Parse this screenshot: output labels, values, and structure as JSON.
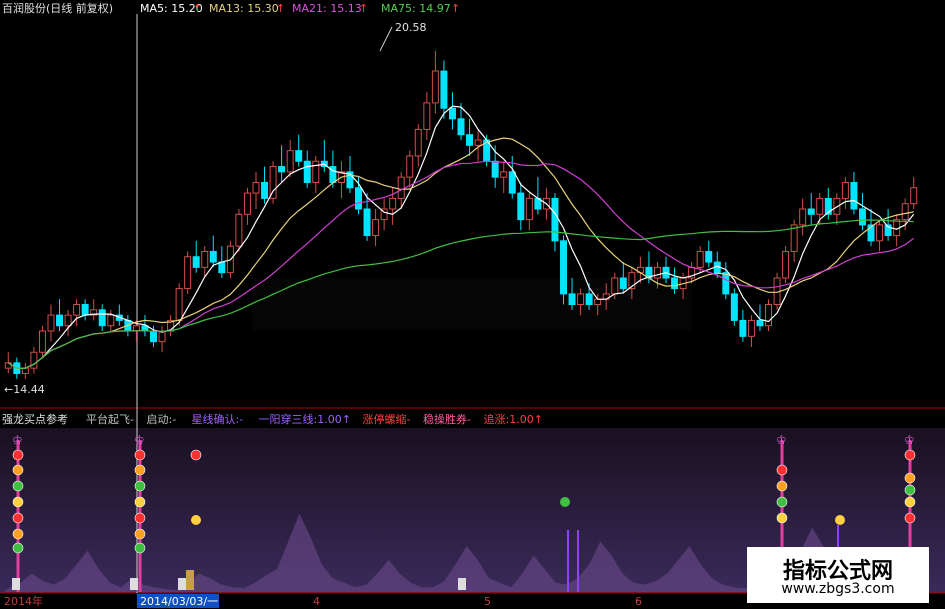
{
  "header": {
    "title": "百润股份(日线 前复权)",
    "ma5": "MA5: 15.20",
    "ma13": "MA13: 15.30",
    "ma21": "MA21: 15.13",
    "ma75": "MA75: 14.97",
    "arrow": "↑"
  },
  "annotations": {
    "high": "20.58",
    "low": "←14.44"
  },
  "indicator": {
    "name": "强龙买点参考",
    "items": [
      {
        "label": "平台起飞",
        "suffix": "-"
      },
      {
        "label": "启动",
        "suffix": ":-"
      },
      {
        "label": "星线确认",
        "suffix": ":-"
      },
      {
        "label": "一阳穿三线",
        "suffix": ":1.00↑"
      },
      {
        "label": "涨停螺缩",
        "suffix": "-"
      },
      {
        "label": "稳操胜券",
        "suffix": "-"
      },
      {
        "label": "追涨",
        "suffix": ":1.00↑"
      }
    ]
  },
  "axis": {
    "labels": [
      "2014年",
      "2014/03/03/一",
      "4",
      "5",
      "6"
    ]
  },
  "watermark": {
    "title": "指标公式网",
    "url": "www.zbgs3.com"
  },
  "colors": {
    "background": "#000000",
    "up": "#d2504c",
    "down": "#00e5ff",
    "ma5": "#ffffff",
    "ma13": "#e8d27a",
    "ma21": "#d040d0",
    "ma75": "#40c040",
    "indicatorBg": "#2a1a3a"
  },
  "chart_data": {
    "type": "candlestick",
    "ylim": [
      14.0,
      21.2
    ],
    "high_marker": 20.58,
    "low_marker": 14.44,
    "candles": [
      [
        14.6,
        14.9,
        14.5,
        14.7
      ],
      [
        14.7,
        14.8,
        14.4,
        14.5
      ],
      [
        14.5,
        14.7,
        14.4,
        14.6
      ],
      [
        14.6,
        15.0,
        14.5,
        14.9
      ],
      [
        14.9,
        15.4,
        14.8,
        15.3
      ],
      [
        15.3,
        15.8,
        15.1,
        15.6
      ],
      [
        15.6,
        15.9,
        15.3,
        15.4
      ],
      [
        15.4,
        15.7,
        15.2,
        15.6
      ],
      [
        15.6,
        15.9,
        15.4,
        15.8
      ],
      [
        15.8,
        15.9,
        15.5,
        15.6
      ],
      [
        15.6,
        15.9,
        15.5,
        15.7
      ],
      [
        15.7,
        15.8,
        15.3,
        15.4
      ],
      [
        15.4,
        15.7,
        15.3,
        15.6
      ],
      [
        15.6,
        15.8,
        15.4,
        15.5
      ],
      [
        15.5,
        15.6,
        15.2,
        15.3
      ],
      [
        15.3,
        15.5,
        15.1,
        15.4
      ],
      [
        15.4,
        15.6,
        15.2,
        15.3
      ],
      [
        15.3,
        15.4,
        15.0,
        15.1
      ],
      [
        15.1,
        15.4,
        14.9,
        15.3
      ],
      [
        15.3,
        15.6,
        15.2,
        15.5
      ],
      [
        15.5,
        16.2,
        15.4,
        16.1
      ],
      [
        16.1,
        16.8,
        16.0,
        16.7
      ],
      [
        16.7,
        17.0,
        16.4,
        16.5
      ],
      [
        16.5,
        16.9,
        16.3,
        16.8
      ],
      [
        16.8,
        17.1,
        16.5,
        16.6
      ],
      [
        16.6,
        16.9,
        16.3,
        16.4
      ],
      [
        16.4,
        17.0,
        16.3,
        16.9
      ],
      [
        16.9,
        17.6,
        16.8,
        17.5
      ],
      [
        17.5,
        18.0,
        17.3,
        17.9
      ],
      [
        17.9,
        18.3,
        17.6,
        18.1
      ],
      [
        18.1,
        18.4,
        17.7,
        17.8
      ],
      [
        17.8,
        18.5,
        17.7,
        18.4
      ],
      [
        18.4,
        18.8,
        18.1,
        18.3
      ],
      [
        18.3,
        18.9,
        18.2,
        18.7
      ],
      [
        18.7,
        19.0,
        18.4,
        18.5
      ],
      [
        18.5,
        18.7,
        18.0,
        18.1
      ],
      [
        18.1,
        18.6,
        17.9,
        18.5
      ],
      [
        18.5,
        18.9,
        18.3,
        18.4
      ],
      [
        18.4,
        18.7,
        18.0,
        18.1
      ],
      [
        18.1,
        18.5,
        17.8,
        18.3
      ],
      [
        18.3,
        18.6,
        17.9,
        18.0
      ],
      [
        18.0,
        18.2,
        17.5,
        17.6
      ],
      [
        17.6,
        17.9,
        17.0,
        17.1
      ],
      [
        17.1,
        17.6,
        16.9,
        17.4
      ],
      [
        17.4,
        17.8,
        17.2,
        17.6
      ],
      [
        17.6,
        18.0,
        17.3,
        17.8
      ],
      [
        17.8,
        18.3,
        17.6,
        18.2
      ],
      [
        18.2,
        18.7,
        18.0,
        18.6
      ],
      [
        18.6,
        19.2,
        18.4,
        19.1
      ],
      [
        19.1,
        19.8,
        18.9,
        19.6
      ],
      [
        19.6,
        20.58,
        19.4,
        20.2
      ],
      [
        20.2,
        20.4,
        19.3,
        19.5
      ],
      [
        19.5,
        19.8,
        19.1,
        19.3
      ],
      [
        19.3,
        19.6,
        18.9,
        19.0
      ],
      [
        19.0,
        19.3,
        18.6,
        18.8
      ],
      [
        18.8,
        19.1,
        18.5,
        18.9
      ],
      [
        18.9,
        19.0,
        18.4,
        18.5
      ],
      [
        18.5,
        18.8,
        18.0,
        18.2
      ],
      [
        18.2,
        18.5,
        17.9,
        18.3
      ],
      [
        18.3,
        18.6,
        17.8,
        17.9
      ],
      [
        17.9,
        18.1,
        17.2,
        17.4
      ],
      [
        17.4,
        17.9,
        17.2,
        17.8
      ],
      [
        17.8,
        18.2,
        17.5,
        17.6
      ],
      [
        17.6,
        18.0,
        17.4,
        17.8
      ],
      [
        17.8,
        17.9,
        16.8,
        17.0
      ],
      [
        17.0,
        17.1,
        15.8,
        16.0
      ],
      [
        16.0,
        16.3,
        15.7,
        15.8
      ],
      [
        15.8,
        16.1,
        15.6,
        16.0
      ],
      [
        16.0,
        16.2,
        15.7,
        15.8
      ],
      [
        15.8,
        16.0,
        15.6,
        15.9
      ],
      [
        15.9,
        16.2,
        15.7,
        16.0
      ],
      [
        16.0,
        16.4,
        15.9,
        16.3
      ],
      [
        16.3,
        16.6,
        16.0,
        16.1
      ],
      [
        16.1,
        16.5,
        15.9,
        16.4
      ],
      [
        16.4,
        16.7,
        16.2,
        16.5
      ],
      [
        16.5,
        16.8,
        16.2,
        16.3
      ],
      [
        16.3,
        16.6,
        16.1,
        16.5
      ],
      [
        16.5,
        16.7,
        16.2,
        16.3
      ],
      [
        16.3,
        16.5,
        16.0,
        16.1
      ],
      [
        16.1,
        16.4,
        15.9,
        16.3
      ],
      [
        16.3,
        16.6,
        16.2,
        16.5
      ],
      [
        16.5,
        16.9,
        16.4,
        16.8
      ],
      [
        16.8,
        17.0,
        16.5,
        16.6
      ],
      [
        16.6,
        16.8,
        16.3,
        16.4
      ],
      [
        16.4,
        16.6,
        15.9,
        16.0
      ],
      [
        16.0,
        16.1,
        15.4,
        15.5
      ],
      [
        15.5,
        15.7,
        15.1,
        15.2
      ],
      [
        15.2,
        15.6,
        15.0,
        15.5
      ],
      [
        15.5,
        15.8,
        15.3,
        15.4
      ],
      [
        15.4,
        15.9,
        15.3,
        15.8
      ],
      [
        15.8,
        16.4,
        15.7,
        16.3
      ],
      [
        16.3,
        16.9,
        16.2,
        16.8
      ],
      [
        16.8,
        17.4,
        16.6,
        17.3
      ],
      [
        17.3,
        17.8,
        17.1,
        17.6
      ],
      [
        17.6,
        17.9,
        17.3,
        17.5
      ],
      [
        17.5,
        17.9,
        17.3,
        17.8
      ],
      [
        17.8,
        18.0,
        17.4,
        17.5
      ],
      [
        17.5,
        17.9,
        17.3,
        17.8
      ],
      [
        17.8,
        18.2,
        17.6,
        18.1
      ],
      [
        18.1,
        18.3,
        17.5,
        17.6
      ],
      [
        17.6,
        17.9,
        17.2,
        17.3
      ],
      [
        17.3,
        17.6,
        16.9,
        17.0
      ],
      [
        17.0,
        17.4,
        16.8,
        17.3
      ],
      [
        17.3,
        17.6,
        17.0,
        17.1
      ],
      [
        17.1,
        17.5,
        16.9,
        17.4
      ],
      [
        17.4,
        17.8,
        17.2,
        17.7
      ],
      [
        17.7,
        18.2,
        17.6,
        18.0
      ]
    ],
    "indicator_heights": [
      0.05,
      0.1,
      0.2,
      0.12,
      0.08,
      0.15,
      0.3,
      0.45,
      0.25,
      0.1,
      0.05,
      0.15,
      0.08,
      0.05,
      0.03,
      0.02,
      0.1,
      0.2,
      0.15,
      0.08,
      0.05,
      0.04,
      0.1,
      0.18,
      0.25,
      0.55,
      0.85,
      0.6,
      0.3,
      0.15,
      0.1,
      0.05,
      0.08,
      0.2,
      0.35,
      0.2,
      0.1,
      0.05,
      0.05,
      0.12,
      0.3,
      0.5,
      0.35,
      0.15,
      0.1,
      0.05,
      0.2,
      0.4,
      0.25,
      0.1,
      0.08,
      0.15,
      0.3,
      0.55,
      0.4,
      0.2,
      0.1,
      0.08,
      0.12,
      0.2,
      0.35,
      0.5,
      0.3,
      0.15,
      0.08,
      0.05,
      0.04,
      0.06,
      0.1,
      0.05,
      0.2,
      0.45,
      0.7,
      0.5,
      0.3,
      0.15,
      0.08,
      0.05,
      0.1,
      0.2,
      0.15,
      0.08
    ]
  }
}
